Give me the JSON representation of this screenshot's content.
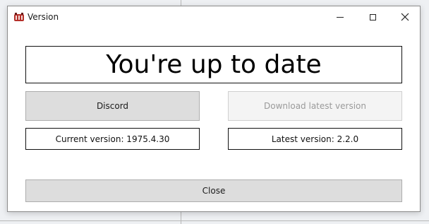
{
  "window": {
    "title": "Version",
    "icon": "app-logo-icon"
  },
  "controls": {
    "minimize_icon": "minimize-icon",
    "maximize_icon": "maximize-icon",
    "close_icon": "close-icon",
    "close_glyph": "✕"
  },
  "status": {
    "message": "You're up to date"
  },
  "buttons": {
    "discord_label": "Discord",
    "download_label": "Download latest version",
    "close_label": "Close"
  },
  "versions": {
    "current": "Current version: 1975.4.30",
    "latest": "Latest version: 2.2.0"
  },
  "colors": {
    "button_bg": "#dddddd",
    "disabled_text": "#9a9a9a",
    "window_bg": "#ffffff"
  }
}
